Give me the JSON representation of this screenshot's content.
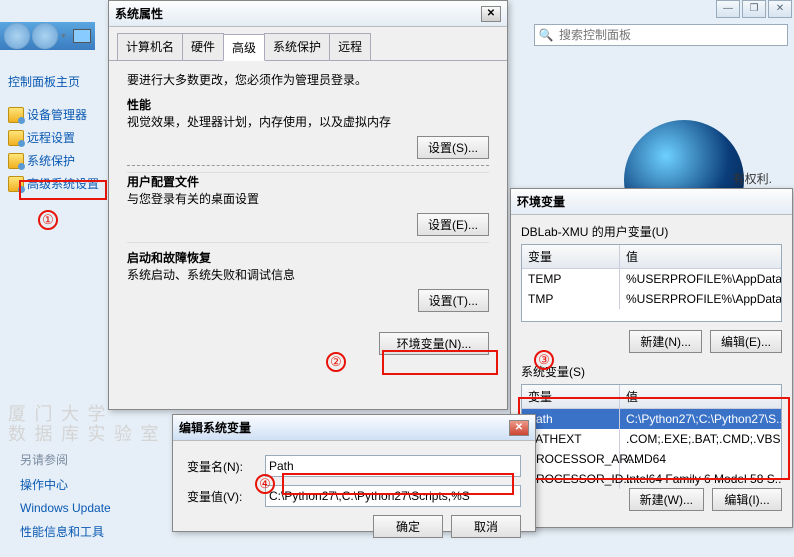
{
  "winctl": {
    "min": "—",
    "max": "❐",
    "close": "✕"
  },
  "toolbar": {
    "search_placeholder": "搜索控制面板"
  },
  "sidebar": {
    "home": "控制面板主页",
    "items": [
      {
        "label": "设备管理器"
      },
      {
        "label": "远程设置"
      },
      {
        "label": "系统保护"
      },
      {
        "label": "高级系统设置"
      }
    ]
  },
  "cp_right_text": "有权利.",
  "watermark": {
    "l1": "厦 门 大 学",
    "l2": "数 据 库 实 验 室"
  },
  "seealso": {
    "title": "另请参阅",
    "links": [
      "操作中心",
      "Windows Update",
      "性能信息和工具"
    ]
  },
  "annot": {
    "n1": "①",
    "n2": "②",
    "n3": "③",
    "n4": "④"
  },
  "sysprop": {
    "title": "系统属性",
    "tabs": [
      "计算机名",
      "硬件",
      "高级",
      "系统保护",
      "远程"
    ],
    "intro": "要进行大多数更改，您必须作为管理员登录。",
    "perf": {
      "h": "性能",
      "d": "视觉效果，处理器计划，内存使用，以及虚拟内存",
      "btn": "设置(S)..."
    },
    "prof": {
      "h": "用户配置文件",
      "d": "与您登录有关的桌面设置",
      "btn": "设置(E)..."
    },
    "boot": {
      "h": "启动和故障恢复",
      "d": "系统启动、系统失败和调试信息",
      "btn": "设置(T)..."
    },
    "envbtn": "环境变量(N)..."
  },
  "env": {
    "title": "环境变量",
    "user_group": "DBLab-XMU 的用户变量(U)",
    "sys_group": "系统变量(S)",
    "col_var": "变量",
    "col_val": "值",
    "user_rows": [
      {
        "v": "TEMP",
        "val": "%USERPROFILE%\\AppData\\Local"
      },
      {
        "v": "TMP",
        "val": "%USERPROFILE%\\AppData\\Local"
      }
    ],
    "sys_rows": [
      {
        "v": "Path",
        "val": "C:\\Python27\\;C:\\Python27\\S..."
      },
      {
        "v": "PATHEXT",
        "val": ".COM;.EXE;.BAT;.CMD;.VBS;..."
      },
      {
        "v": "PROCESSOR_AR...",
        "val": "AMD64"
      },
      {
        "v": "PROCESSOR_ID...",
        "val": "Intel64 Family 6 Model 58 S..."
      }
    ],
    "btn_new": "新建(W)...",
    "btn_edit": "编辑(I)...",
    "btn_new_u": "新建(N)...",
    "btn_edit_u": "编辑(E)..."
  },
  "editvar": {
    "title": "编辑系统变量",
    "name_l": "变量名(N):",
    "name_v": "Path",
    "val_l": "变量值(V):",
    "val_v": "C:\\Python27\\;C:\\Python27\\Scripts;%S",
    "ok": "确定",
    "cancel": "取消"
  }
}
